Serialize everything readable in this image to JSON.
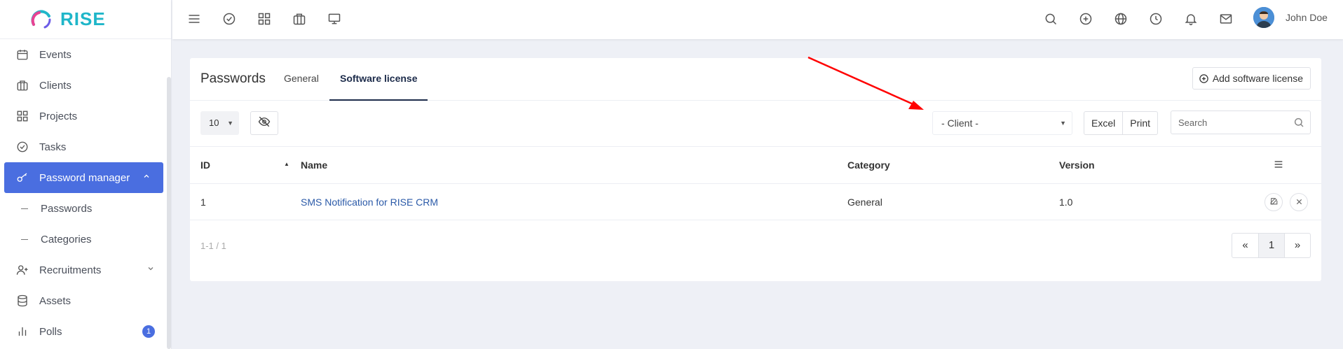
{
  "brand": {
    "name": "RISE"
  },
  "sidebar": {
    "items": [
      {
        "label": "Events",
        "icon": "calendar-icon"
      },
      {
        "label": "Clients",
        "icon": "briefcase-icon"
      },
      {
        "label": "Projects",
        "icon": "grid-icon"
      },
      {
        "label": "Tasks",
        "icon": "check-circle-icon"
      },
      {
        "label": "Password manager",
        "icon": "key-icon",
        "active": true,
        "expanded": true
      },
      {
        "label": "Passwords",
        "sub": true
      },
      {
        "label": "Categories",
        "sub": true
      },
      {
        "label": "Recruitments",
        "icon": "user-plus-icon"
      },
      {
        "label": "Assets",
        "icon": "database-icon"
      },
      {
        "label": "Polls",
        "icon": "bar-chart-icon",
        "badge": "1"
      }
    ]
  },
  "topbar": {
    "user_name": "John Doe",
    "icons": [
      "menu-icon",
      "check-circle-icon",
      "grid-icon",
      "briefcase-icon",
      "monitor-icon",
      "search-icon",
      "plus-circle-icon",
      "globe-icon",
      "clock-icon",
      "bell-icon",
      "mail-icon"
    ]
  },
  "card": {
    "title": "Passwords",
    "tabs": [
      {
        "label": "General"
      },
      {
        "label": "Software license",
        "active": true
      }
    ],
    "add_button": "Add software license"
  },
  "toolbar": {
    "page_size": "10",
    "client_filter": "- Client -",
    "excel": "Excel",
    "print": "Print",
    "search_placeholder": "Search"
  },
  "table": {
    "headers": {
      "id": "ID",
      "name": "Name",
      "category": "Category",
      "version": "Version"
    },
    "rows": [
      {
        "id": "1",
        "name": "SMS Notification for RISE CRM",
        "category": "General",
        "version": "1.0"
      }
    ]
  },
  "footer": {
    "range": "1-1 / 1",
    "first": "«",
    "page": "1",
    "last": "»"
  },
  "colors": {
    "accent": "#4a6ee0",
    "brand": "#1fb6c9",
    "link": "#2b5aa8",
    "annotation_arrow": "#ff0000"
  }
}
